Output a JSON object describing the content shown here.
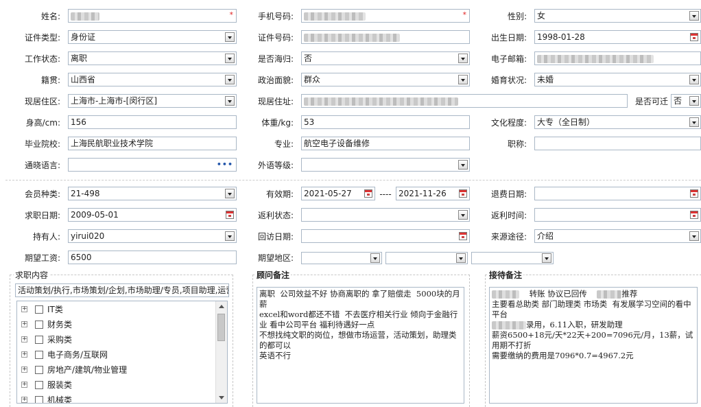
{
  "basic": {
    "name_label": "姓名:",
    "phone_label": "手机号码:",
    "gender_label": "性别:",
    "gender_value": "女",
    "id_type_label": "证件类型:",
    "id_type_value": "身份证",
    "id_no_label": "证件号码:",
    "birth_label": "出生日期:",
    "birth_value": "1998-01-28",
    "work_status_label": "工作状态:",
    "work_status_value": "离职",
    "returnee_label": "是否海归:",
    "returnee_value": "否",
    "email_label": "电子邮箱:",
    "native_label": "籍贯:",
    "native_value": "山西省",
    "political_label": "政治面貌:",
    "political_value": "群众",
    "marital_label": "婚育状况:",
    "marital_value": "未婚",
    "residence_area_label": "现居住区:",
    "residence_area_value": "上海市-上海市-[闵行区]",
    "address_label": "现居住址:",
    "relocate_label": "是否可迁",
    "relocate_value": "否",
    "height_label": "身高/cm:",
    "height_value": "156",
    "weight_label": "体重/kg:",
    "weight_value": "53",
    "education_label": "文化程度:",
    "education_value": "大专（全日制）",
    "school_label": "毕业院校:",
    "school_value": "上海民航职业技术学院",
    "major_label": "专业:",
    "major_value": "航空电子设备维修",
    "title_label": "职称:",
    "languages_label": "通晓语言:",
    "foreign_level_label": "外语等级:"
  },
  "membership": {
    "member_type_label": "会员种类:",
    "member_type_value": "21-498",
    "valid_label": "有效期:",
    "valid_from": "2021-05-27",
    "valid_sep": "----",
    "valid_to": "2021-11-26",
    "refund_date_label": "退费日期:",
    "job_date_label": "求职日期:",
    "job_date_value": "2009-05-01",
    "rebate_status_label": "返利状态:",
    "rebate_time_label": "返利时间:",
    "holder_label": "持有人:",
    "holder_value": "yirui020",
    "visit_date_label": "回访日期:",
    "source_label": "来源途径:",
    "source_value": "介绍",
    "salary_label": "期望工资:",
    "salary_value": "6500",
    "area_label": "期望地区:"
  },
  "job_panel": {
    "title": "求职内容",
    "content": "活动策划/执行,市场策划/企划,市场助理/专员,项目助理,运营",
    "tree": [
      "IT类",
      "财务类",
      "采购类",
      "电子商务/互联网",
      "房地产/建筑/物业管理",
      "服装类",
      "机械类"
    ]
  },
  "consultant_panel": {
    "title": "顾问备注",
    "lines": [
      "离职  公司效益不好 协商离职的 拿了赔偿走  5000块的月薪",
      "excel和word都还不错  不去医疗相关行业 倾向于金融行业 看中公司平台 福利待遇好一点",
      "不想找纯文职的岗位，想做市场运营，活动策划，助理类的都可以",
      "英语不行"
    ]
  },
  "reception_panel": {
    "title": "接待备注",
    "line1_a": "转账 协议已回传",
    "line1_b": "推荐",
    "line2": "主要看总助类 部门助理类 市场类  有发展学习空间的看中平台",
    "line3": "录用，6.11入职，研发助理",
    "line4": "薪资6500+18元/天*22天+200=7096元/月，13薪，试用期不打折",
    "line5": "需要缴纳的费用是7096*0.7=4967.2元"
  }
}
